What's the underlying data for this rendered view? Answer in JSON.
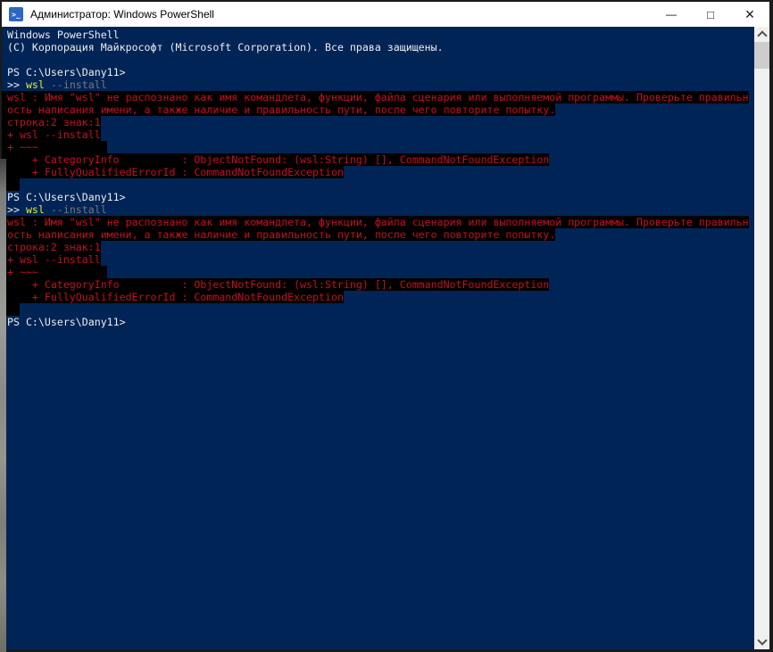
{
  "window": {
    "title": "Администратор: Windows PowerShell",
    "icon_glyph": ">_",
    "controls": {
      "minimize": "—",
      "maximize": "□",
      "close": "×"
    }
  },
  "terminal": {
    "banner_line1": "Windows PowerShell",
    "banner_line2": "(C) Корпорация Майкрософт (Microsoft Corporation). Все права защищены.",
    "prompt": "PS C:\\Users\\Dany11>",
    "command": {
      "continuation": ">> ",
      "name": "wsl",
      "args": " --install"
    },
    "error": {
      "message_line1": "wsl : Имя \"wsl\" не распознано как имя командлета, функции, файла сценария или выполняемой программы. Проверьте правильн",
      "message_line2": "ость написания имени, а также наличие и правильность пути, после чего повторите попытку.",
      "position": "строка:2 знак:1",
      "command_echo": "+ wsl --install",
      "caret": "+ ~~~           ",
      "category_info": "    + CategoryInfo          : ObjectNotFound: (wsl:String) [], CommandNotFoundException",
      "fully_qualified_error_id": "    + FullyQualifiedErrorId : CommandNotFoundException",
      "block_trailer": "  "
    },
    "colors": {
      "background": "#012456",
      "foreground": "#ededec",
      "error_red": "#c50f1f",
      "error_background": "#000000",
      "command_yellow": "#e8e830",
      "parameter_gray": "#767676"
    }
  }
}
